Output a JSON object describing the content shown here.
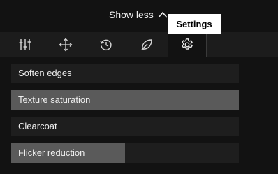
{
  "header": {
    "toggle_label": "Show less",
    "toggle_icon": "chevron-up-icon"
  },
  "tooltip": {
    "text": "Settings"
  },
  "tabs": [
    {
      "name": "adjustments",
      "icon": "sliders-icon",
      "active": false
    },
    {
      "name": "transform",
      "icon": "move-arrows-icon",
      "active": false
    },
    {
      "name": "history",
      "icon": "history-icon",
      "active": false
    },
    {
      "name": "eco",
      "icon": "leaf-icon",
      "active": false
    },
    {
      "name": "settings",
      "icon": "gear-icon",
      "active": true
    }
  ],
  "sliders": [
    {
      "label": "Soften edges",
      "value_fraction": 0.0
    },
    {
      "label": "Texture saturation",
      "value_fraction": 1.0
    },
    {
      "label": "Clearcoat",
      "value_fraction": 0.0
    },
    {
      "label": "Flicker reduction",
      "value_fraction": 0.5
    }
  ],
  "colors": {
    "background": "#121212",
    "tab_strip": "#1c1c1c",
    "slider_track": "#1e1e1e",
    "slider_fill": "#5a5a5a",
    "tooltip_bg": "#ffffff"
  }
}
